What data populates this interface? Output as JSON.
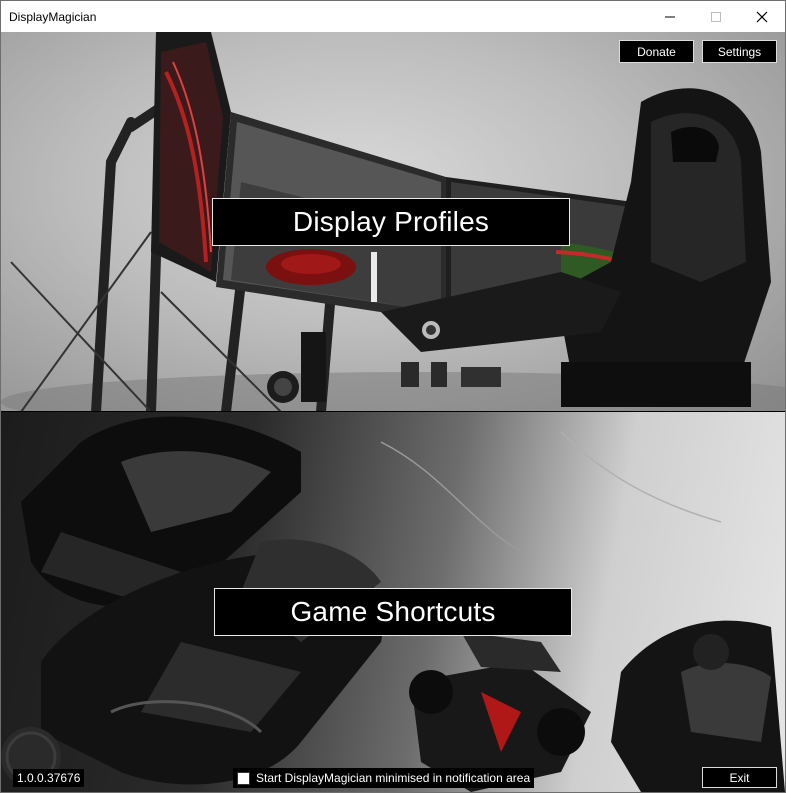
{
  "window": {
    "title": "DisplayMagician",
    "controls": [
      "minimize-icon",
      "maximize-icon",
      "close-icon"
    ]
  },
  "header": {
    "donate_label": "Donate",
    "settings_label": "Settings"
  },
  "main": {
    "display_profiles_label": "Display Profiles",
    "game_shortcuts_label": "Game Shortcuts"
  },
  "footer": {
    "version": "1.0.0.37676",
    "minimise_label": "Start DisplayMagician minimised in notification area",
    "minimise_checked": false,
    "exit_label": "Exit"
  },
  "colors": {
    "button_bg": "#000000",
    "button_text": "#ffffff",
    "titlebar_bg": "#ffffff"
  }
}
